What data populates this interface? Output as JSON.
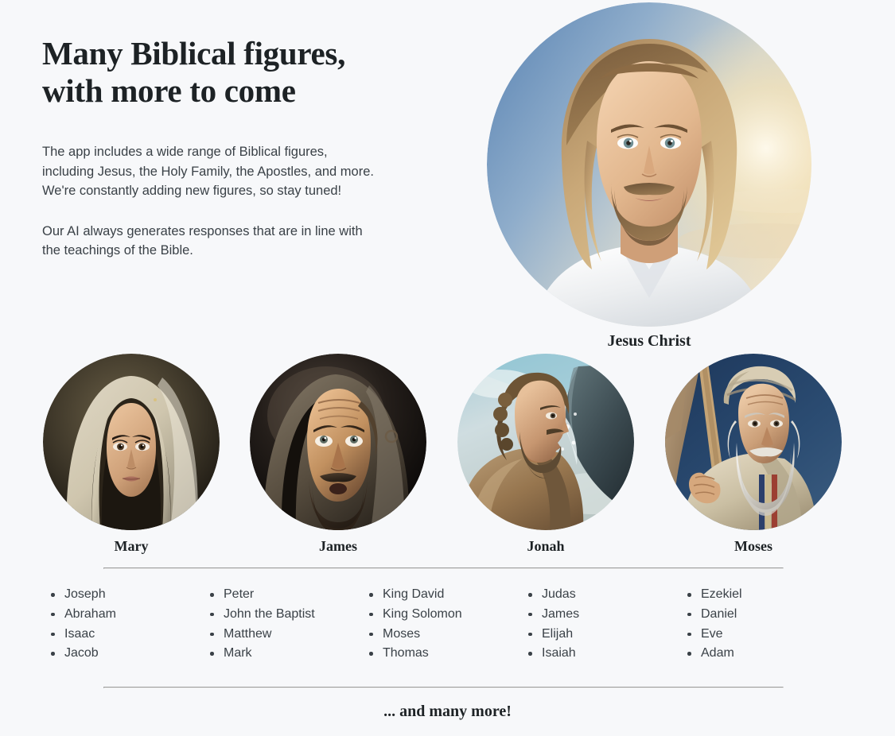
{
  "hero": {
    "title": "Many Biblical figures, with more to come",
    "paragraph_1": "The app includes a wide range of Biblical figures, including Jesus, the Holy Family, the Apostles, and more. We're constantly adding new figures, so stay tuned!",
    "paragraph_2": "Our AI always generates responses that are in line with the teachings of the Bible."
  },
  "featured": {
    "name": "Jesus Christ",
    "image_name": "jesus-portrait"
  },
  "portraits": [
    {
      "name": "Mary",
      "image_name": "mary-portrait"
    },
    {
      "name": "James",
      "image_name": "james-portrait"
    },
    {
      "name": "Jonah",
      "image_name": "jonah-portrait"
    },
    {
      "name": "Moses",
      "image_name": "moses-portrait"
    }
  ],
  "name_columns": [
    {
      "items": [
        "Joseph",
        "Abraham",
        "Isaac",
        "Jacob"
      ]
    },
    {
      "items": [
        "Peter",
        "John the Baptist",
        "Matthew",
        "Mark"
      ]
    },
    {
      "items": [
        "King David",
        "King Solomon",
        "Moses",
        "Thomas"
      ]
    },
    {
      "items": [
        "Judas",
        "James",
        "Elijah",
        "Isaiah"
      ]
    },
    {
      "items": [
        "Ezekiel",
        "Daniel",
        "Eve",
        "Adam"
      ]
    }
  ],
  "footer": {
    "note": "... and many more!"
  },
  "colors": {
    "background": "#f7f8fa",
    "heading": "#1d2225",
    "body_text": "#3a4147",
    "divider": "#e3e5e9"
  }
}
